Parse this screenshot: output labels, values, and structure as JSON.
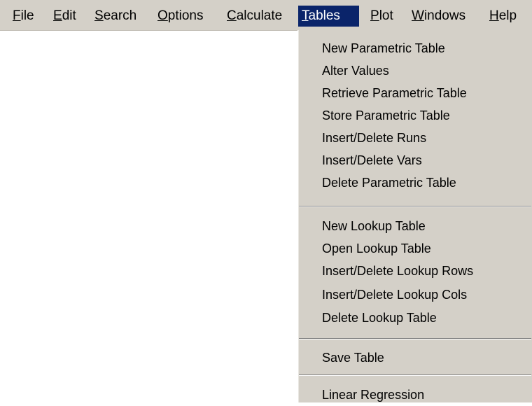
{
  "menubar": {
    "items": [
      {
        "label": "File",
        "mnemonic": "F",
        "rest": "ile",
        "active": false
      },
      {
        "label": "Edit",
        "mnemonic": "E",
        "rest": "dit",
        "active": false
      },
      {
        "label": "Search",
        "mnemonic": "S",
        "rest": "earch",
        "active": false
      },
      {
        "label": "Options",
        "mnemonic": "O",
        "rest": "ptions",
        "active": false
      },
      {
        "label": "Calculate",
        "mnemonic": "C",
        "rest": "alculate",
        "active": false
      },
      {
        "label": "Tables",
        "mnemonic": "T",
        "rest": "ables",
        "active": true
      },
      {
        "label": "Plot",
        "mnemonic": "P",
        "rest": "lot",
        "active": false
      },
      {
        "label": "Windows",
        "mnemonic": "W",
        "rest": "indows",
        "active": false
      },
      {
        "label": "Help",
        "mnemonic": "H",
        "rest": "elp",
        "active": false
      }
    ]
  },
  "tables_menu": {
    "groups": [
      {
        "items": [
          "New Parametric Table",
          "Alter Values",
          "Retrieve Parametric Table",
          "Store Parametric Table",
          "Insert/Delete Runs",
          "Insert/Delete Vars",
          "Delete Parametric Table"
        ]
      },
      {
        "items": [
          "New Lookup Table",
          "Open Lookup Table",
          "Insert/Delete Lookup Rows",
          "Insert/Delete Lookup Cols",
          "Delete Lookup Table"
        ]
      },
      {
        "items": [
          "Save Table"
        ]
      },
      {
        "items": [
          "Linear Regression"
        ]
      }
    ]
  },
  "colors": {
    "menu_background": "#d4d0c8",
    "highlight": "#0a246a",
    "highlight_text": "#ffffff"
  }
}
